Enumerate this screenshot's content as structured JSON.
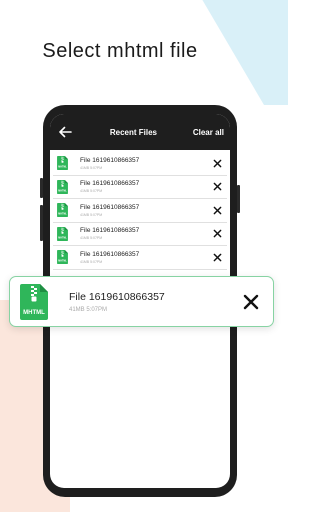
{
  "headline": "Select mhtml file",
  "appbar": {
    "title": "Recent Files",
    "clear_all": "Clear all"
  },
  "file_icon_label": "MHTML",
  "rows": [
    {
      "name": "File 1619610866357",
      "meta": "41MB 5:07PM"
    },
    {
      "name": "File 1619610866357",
      "meta": "41MB 5:07PM"
    },
    {
      "name": "File 1619610866357",
      "meta": "41MB 5:07PM"
    },
    {
      "name": "File 1619610866357",
      "meta": "41MB 5:07PM"
    },
    {
      "name": "File 1619610866357",
      "meta": "41MB 5:07PM"
    }
  ],
  "card": {
    "name": "File 1619610866357",
    "meta": "41MB 5:07PM"
  },
  "colors": {
    "accent_green": "#2fb65a",
    "card_border": "#87d3a3",
    "appbar": "#1e1e1e"
  }
}
